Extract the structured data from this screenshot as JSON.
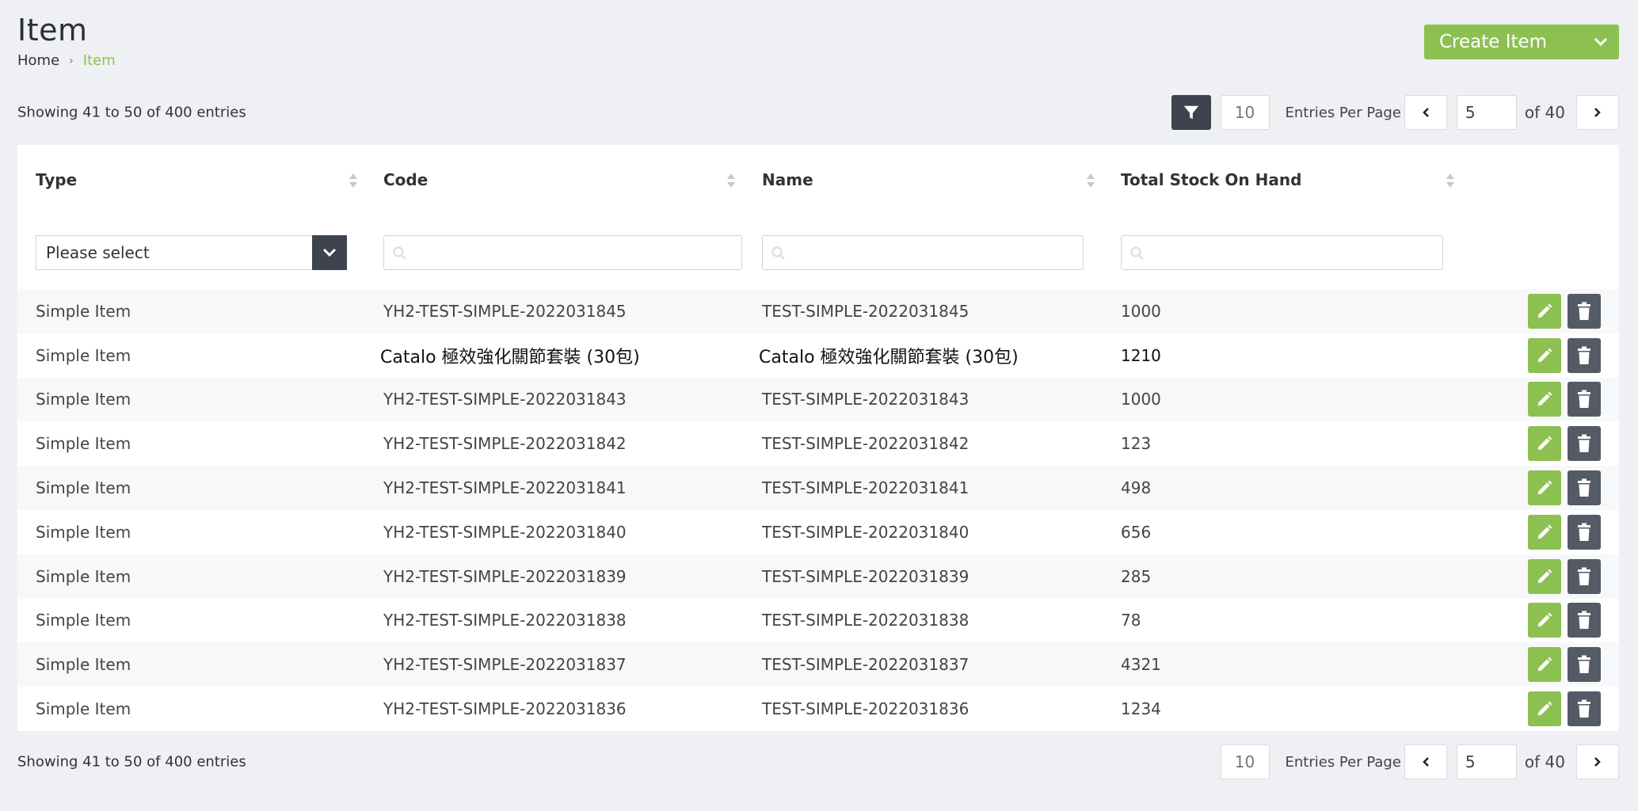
{
  "page": {
    "title": "Item",
    "breadcrumb": {
      "home": "Home",
      "current": "Item"
    },
    "create_button_label": "Create Item"
  },
  "pagination": {
    "entries_info": "Showing 41 to 50 of 400 entries",
    "per_page": "10",
    "per_page_label": "Entries Per Page",
    "current_page": "5",
    "of_label": "of 40"
  },
  "table": {
    "headers": {
      "type": "Type",
      "code": "Code",
      "name": "Name",
      "stock": "Total Stock On Hand"
    },
    "filters": {
      "type_select_value": "Please select"
    },
    "rows": [
      {
        "type": "Simple Item",
        "code": "YH2-TEST-SIMPLE-2022031845",
        "name": "TEST-SIMPLE-2022031845",
        "stock": "1000"
      },
      {
        "type": "Simple Item",
        "code": "Catalo 極效強化關節套裝 (30包)",
        "name": "Catalo 極效強化關節套裝 (30包)",
        "stock": "1210"
      },
      {
        "type": "Simple Item",
        "code": "YH2-TEST-SIMPLE-2022031843",
        "name": "TEST-SIMPLE-2022031843",
        "stock": "1000"
      },
      {
        "type": "Simple Item",
        "code": "YH2-TEST-SIMPLE-2022031842",
        "name": "TEST-SIMPLE-2022031842",
        "stock": "123"
      },
      {
        "type": "Simple Item",
        "code": "YH2-TEST-SIMPLE-2022031841",
        "name": "TEST-SIMPLE-2022031841",
        "stock": "498"
      },
      {
        "type": "Simple Item",
        "code": "YH2-TEST-SIMPLE-2022031840",
        "name": "TEST-SIMPLE-2022031840",
        "stock": "656"
      },
      {
        "type": "Simple Item",
        "code": "YH2-TEST-SIMPLE-2022031839",
        "name": "TEST-SIMPLE-2022031839",
        "stock": "285"
      },
      {
        "type": "Simple Item",
        "code": "YH2-TEST-SIMPLE-2022031838",
        "name": "TEST-SIMPLE-2022031838",
        "stock": "78"
      },
      {
        "type": "Simple Item",
        "code": "YH2-TEST-SIMPLE-2022031837",
        "name": "TEST-SIMPLE-2022031837",
        "stock": "4321"
      },
      {
        "type": "Simple Item",
        "code": "YH2-TEST-SIMPLE-2022031836",
        "name": "TEST-SIMPLE-2022031836",
        "stock": "1234"
      }
    ]
  },
  "icons": {
    "filter": "filter-icon",
    "create_caret": "chevron-down-icon",
    "prev": "chevron-left-icon",
    "next": "chevron-right-icon",
    "search": "search-icon",
    "edit": "pencil-icon",
    "delete": "trash-icon"
  },
  "colors": {
    "accent_green": "#8cc152",
    "dark_button": "#3d4450",
    "delete_button": "#545b65",
    "page_background": "#eff0f4"
  }
}
